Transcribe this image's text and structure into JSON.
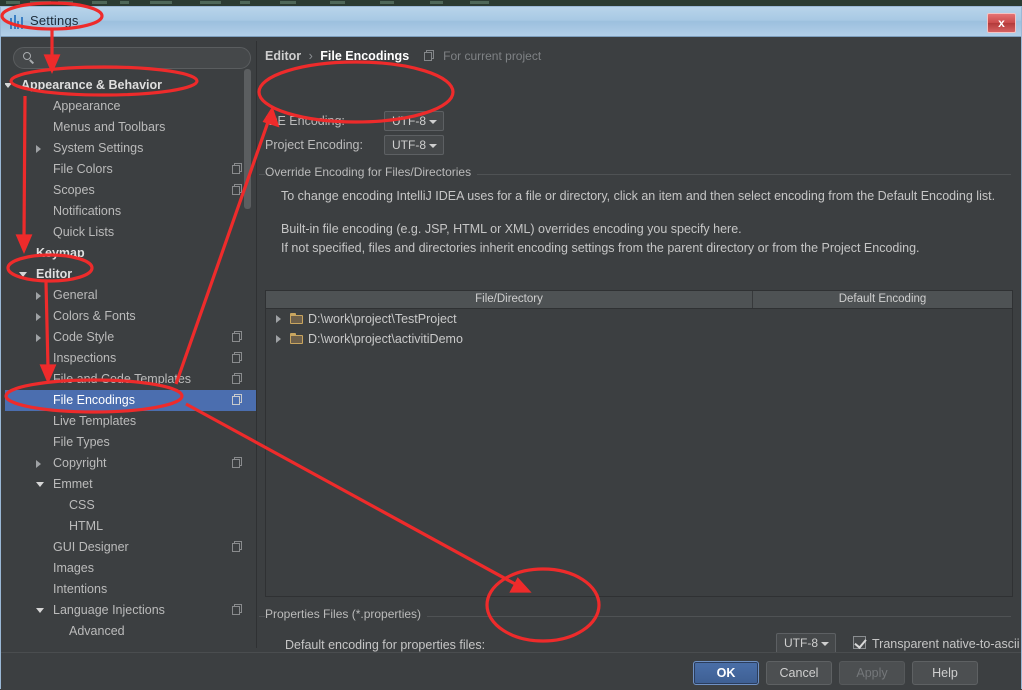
{
  "window": {
    "title": "Settings",
    "close_label": "x",
    "app_icon": "intellij-icon",
    "close_icon": "close-icon"
  },
  "sidebar": {
    "search": {
      "value": "",
      "placeholder": "",
      "icon": "search-icon"
    },
    "items": [
      {
        "label": "Appearance & Behavior",
        "indent": 16,
        "arrow": "down",
        "bold": true,
        "cfg": false,
        "selected": false
      },
      {
        "label": "Appearance",
        "indent": 48,
        "arrow": "none",
        "bold": false,
        "cfg": false,
        "selected": false
      },
      {
        "label": "Menus and Toolbars",
        "indent": 48,
        "arrow": "none",
        "bold": false,
        "cfg": false,
        "selected": false
      },
      {
        "label": "System Settings",
        "indent": 48,
        "arrow": "right",
        "bold": false,
        "cfg": false,
        "selected": false
      },
      {
        "label": "File Colors",
        "indent": 48,
        "arrow": "none",
        "bold": false,
        "cfg": true,
        "selected": false
      },
      {
        "label": "Scopes",
        "indent": 48,
        "arrow": "none",
        "bold": false,
        "cfg": true,
        "selected": false
      },
      {
        "label": "Notifications",
        "indent": 48,
        "arrow": "none",
        "bold": false,
        "cfg": false,
        "selected": false
      },
      {
        "label": "Quick Lists",
        "indent": 48,
        "arrow": "none",
        "bold": false,
        "cfg": false,
        "selected": false
      },
      {
        "label": "Keymap",
        "indent": 31,
        "arrow": "none",
        "bold": true,
        "cfg": false,
        "selected": false
      },
      {
        "label": "Editor",
        "indent": 31,
        "arrow": "down",
        "bold": true,
        "cfg": false,
        "selected": false
      },
      {
        "label": "General",
        "indent": 48,
        "arrow": "right",
        "bold": false,
        "cfg": false,
        "selected": false
      },
      {
        "label": "Colors & Fonts",
        "indent": 48,
        "arrow": "right",
        "bold": false,
        "cfg": false,
        "selected": false
      },
      {
        "label": "Code Style",
        "indent": 48,
        "arrow": "right",
        "bold": false,
        "cfg": true,
        "selected": false
      },
      {
        "label": "Inspections",
        "indent": 48,
        "arrow": "none",
        "bold": false,
        "cfg": true,
        "selected": false
      },
      {
        "label": "File and Code Templates",
        "indent": 48,
        "arrow": "none",
        "bold": false,
        "cfg": true,
        "selected": false
      },
      {
        "label": "File Encodings",
        "indent": 48,
        "arrow": "none",
        "bold": false,
        "cfg": true,
        "selected": true
      },
      {
        "label": "Live Templates",
        "indent": 48,
        "arrow": "none",
        "bold": false,
        "cfg": false,
        "selected": false
      },
      {
        "label": "File Types",
        "indent": 48,
        "arrow": "none",
        "bold": false,
        "cfg": false,
        "selected": false
      },
      {
        "label": "Copyright",
        "indent": 48,
        "arrow": "right",
        "bold": false,
        "cfg": true,
        "selected": false
      },
      {
        "label": "Emmet",
        "indent": 48,
        "arrow": "down",
        "bold": false,
        "cfg": false,
        "selected": false
      },
      {
        "label": "CSS",
        "indent": 64,
        "arrow": "none",
        "bold": false,
        "cfg": false,
        "selected": false
      },
      {
        "label": "HTML",
        "indent": 64,
        "arrow": "none",
        "bold": false,
        "cfg": false,
        "selected": false
      },
      {
        "label": "GUI Designer",
        "indent": 48,
        "arrow": "none",
        "bold": false,
        "cfg": true,
        "selected": false
      },
      {
        "label": "Images",
        "indent": 48,
        "arrow": "none",
        "bold": false,
        "cfg": false,
        "selected": false
      },
      {
        "label": "Intentions",
        "indent": 48,
        "arrow": "none",
        "bold": false,
        "cfg": false,
        "selected": false
      },
      {
        "label": "Language Injections",
        "indent": 48,
        "arrow": "down",
        "bold": false,
        "cfg": true,
        "selected": false
      },
      {
        "label": "Advanced",
        "indent": 64,
        "arrow": "none",
        "bold": false,
        "cfg": false,
        "selected": false
      }
    ]
  },
  "main": {
    "breadcrumb": {
      "parent": "Editor",
      "separator": "›",
      "current": "File Encodings",
      "scope": "For current project",
      "scope_icon": "project-scope-icon"
    },
    "ide_encoding": {
      "label": "IDE Encoding:",
      "value": "UTF-8"
    },
    "project_encoding": {
      "label": "Project Encoding:",
      "value": "UTF-8"
    },
    "override_group_title": "Override Encoding for Files/Directories",
    "description_para1": "To change encoding IntelliJ IDEA uses for a file or directory, click an item and then select encoding from the Default Encoding list.",
    "description_para2": "Built-in file encoding (e.g. JSP, HTML or XML) overrides encoding you specify here.",
    "description_para3": "If not specified, files and directories inherit encoding settings from the parent directory or from the Project Encoding.",
    "table": {
      "columns": [
        "File/Directory",
        "Default Encoding"
      ],
      "rows": [
        {
          "path": "D:\\work\\project\\TestProject",
          "encoding": ""
        },
        {
          "path": "D:\\work\\project\\activitiDemo",
          "encoding": ""
        }
      ]
    },
    "properties_group_title": "Properties Files (*.properties)",
    "properties_default_label": "Default encoding for properties files:",
    "properties_default_value": "UTF-8",
    "transparent_checkbox": {
      "label": "Transparent native-to-ascii conversion",
      "checked": true
    }
  },
  "footer": {
    "buttons": [
      {
        "label": "OK",
        "style": "primary"
      },
      {
        "label": "Cancel",
        "style": "normal"
      },
      {
        "label": "Apply",
        "style": "disabled"
      },
      {
        "label": "Help",
        "style": "normal"
      }
    ]
  },
  "colors": {
    "panel_bg": "#3c3f41",
    "selection_blue": "#4b6eaf",
    "annotation_red": "#ee2b2b",
    "titlebar_blue": "#a8c9e4"
  }
}
